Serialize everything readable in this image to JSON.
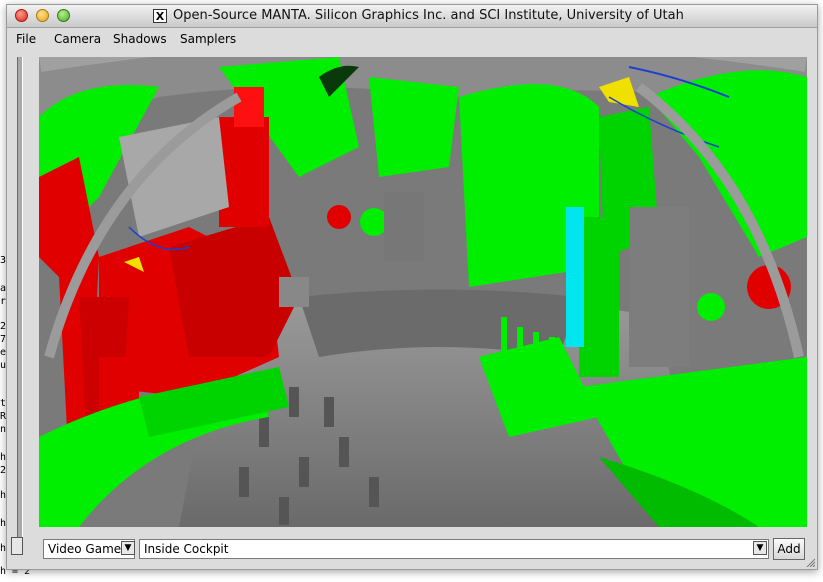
{
  "window": {
    "title": "Open-Source MANTA. Silicon Graphics Inc. and SCI Institute, University of Utah",
    "x_icon_label": "X"
  },
  "menu": [
    {
      "label": "File"
    },
    {
      "label": "Camera"
    },
    {
      "label": "Shadows"
    },
    {
      "label": "Samplers"
    }
  ],
  "controls": {
    "scene_mode": "Video Game",
    "camera_bookmark": "Inside Cockpit",
    "add_label": "Add"
  },
  "background_terminal": {
    "fragments": [
      "3",
      "a",
      "r",
      "2",
      "7",
      "e",
      "u",
      "t",
      "R",
      "n",
      "h",
      "2",
      "h",
      "h",
      "h"
    ],
    "bottom_line": "h = 2"
  },
  "colors": {
    "green": "#00ee00",
    "red": "#e00000",
    "grey": "#8a8a8a",
    "cyan": "#00e5ee",
    "window_bg": "#dcdcdc"
  }
}
